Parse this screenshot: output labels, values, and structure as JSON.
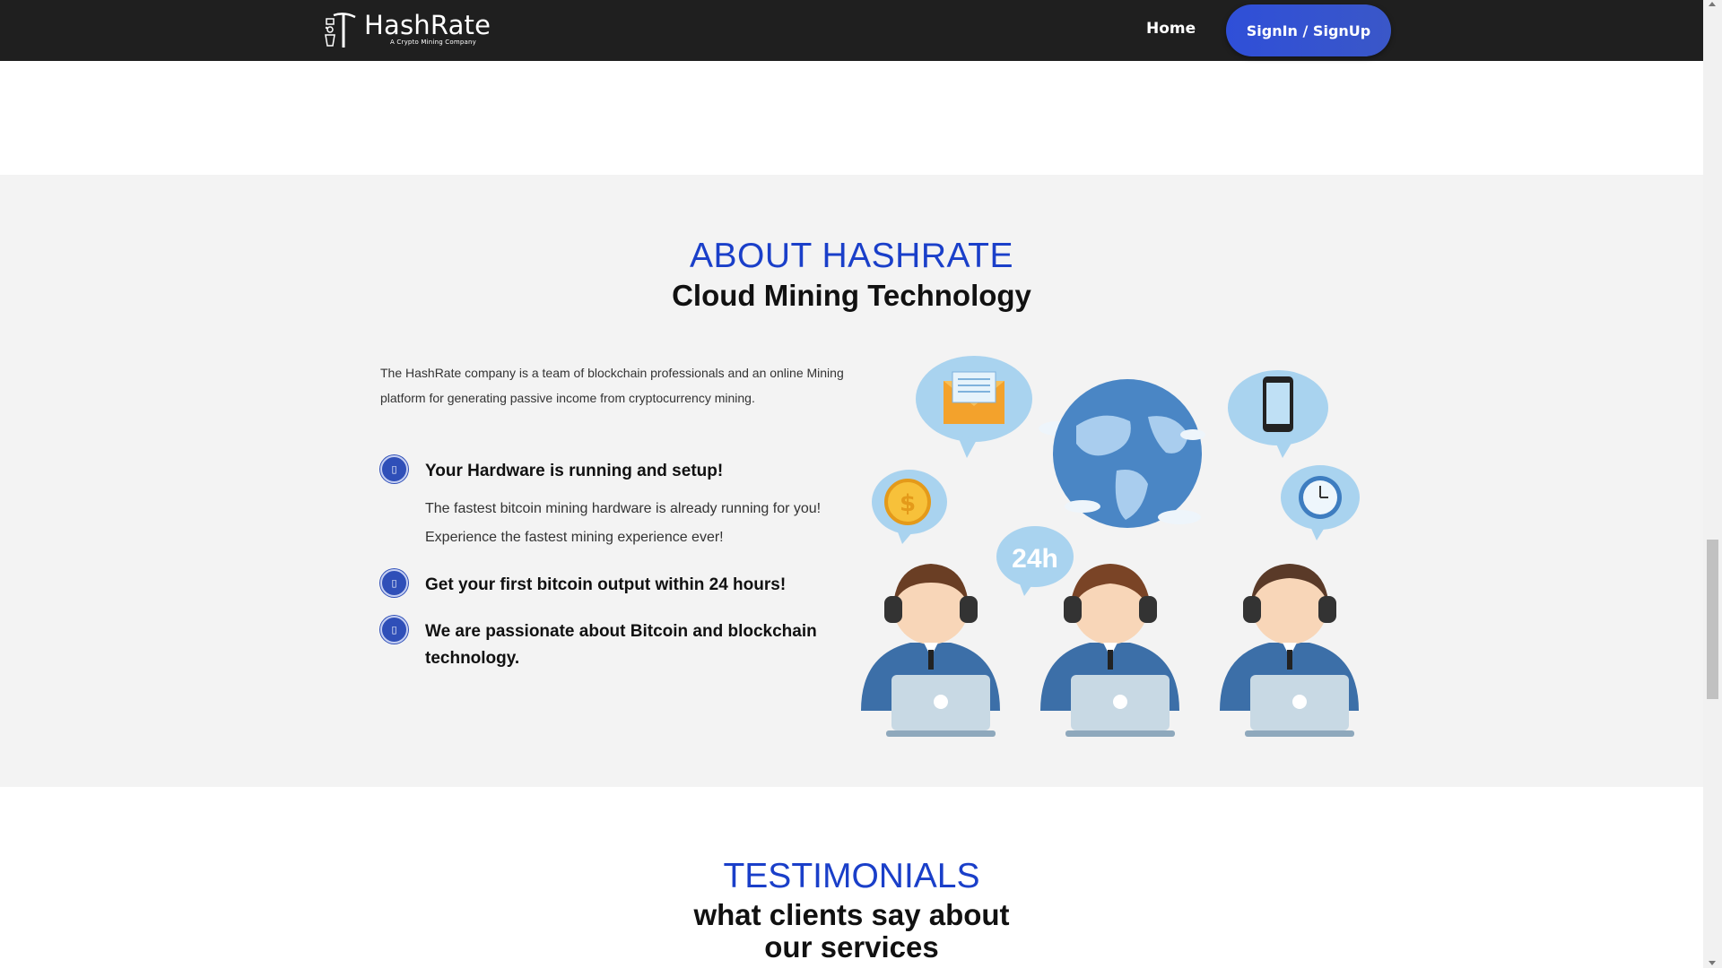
{
  "nav": {
    "brand": "HashRate",
    "tagline": "A Crypto Mining Company",
    "home_label": "Home",
    "signin_label": "SignIn / SignUp"
  },
  "about": {
    "title": "ABOUT HASHRATE",
    "subtitle": "Cloud Mining Technology",
    "description": "The HashRate company is a team of blockchain professionals and an online Mining platform for generating passive income from cryptocurrency mining.",
    "features": [
      {
        "icon": "square-bullet-icon",
        "title": "Your Hardware is running and setup!",
        "body": "The fastest bitcoin mining hardware is already running for you! Experience the fastest mining experience ever!"
      },
      {
        "icon": "square-bullet-icon",
        "title": "Get your first bitcoin output within 24 hours!"
      },
      {
        "icon": "square-bullet-icon",
        "title": "We are passionate about Bitcoin and blockchain technology."
      }
    ],
    "illustration_label": "24h"
  },
  "testimonials": {
    "title": "TESTIMONIALS",
    "subtitle_line1": "what clients say about",
    "subtitle_line2": "our services"
  },
  "colors": {
    "navbar": "#1f1f1f",
    "accent": "#1a3fc9",
    "button": "#2f4fd8",
    "section_bg": "#f3f3f3"
  }
}
